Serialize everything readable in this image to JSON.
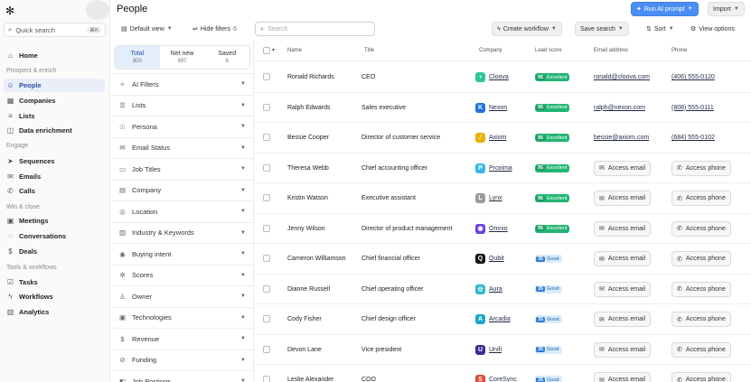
{
  "sidebar": {
    "quick_search": {
      "label": "Quick search",
      "shortcut": "⌘K"
    },
    "sections": [
      {
        "title": "",
        "items": [
          {
            "label": "Home",
            "icon": "home-icon",
            "glyph": "⌂"
          }
        ]
      },
      {
        "title": "Prospect & enrich",
        "items": [
          {
            "label": "People",
            "icon": "people-icon",
            "glyph": "☺",
            "active": true
          },
          {
            "label": "Companies",
            "icon": "building-icon",
            "glyph": "▦"
          },
          {
            "label": "Lists",
            "icon": "list-icon",
            "glyph": "≡"
          },
          {
            "label": "Data enrichment",
            "icon": "database-icon",
            "glyph": "◫"
          }
        ]
      },
      {
        "title": "Engage",
        "items": [
          {
            "label": "Sequences",
            "icon": "send-icon",
            "glyph": "➤"
          },
          {
            "label": "Emails",
            "icon": "mail-icon",
            "glyph": "✉"
          },
          {
            "label": "Calls",
            "icon": "phone-icon",
            "glyph": "✆"
          }
        ]
      },
      {
        "title": "Win & close",
        "items": [
          {
            "label": "Meetings",
            "icon": "calendar-icon",
            "glyph": "▣"
          },
          {
            "label": "Conversations",
            "icon": "chat-icon",
            "glyph": "◌"
          },
          {
            "label": "Deals",
            "icon": "dollar-icon",
            "glyph": "$"
          }
        ]
      },
      {
        "title": "Tools & workflows",
        "items": [
          {
            "label": "Tasks",
            "icon": "checklist-icon",
            "glyph": "☑"
          },
          {
            "label": "Workflows",
            "icon": "bolt-icon",
            "glyph": "ϟ"
          },
          {
            "label": "Analytics",
            "icon": "chart-icon",
            "glyph": "▥"
          }
        ]
      }
    ]
  },
  "header": {
    "title": "People",
    "view": "Default view",
    "hide_filters": "Hide filters",
    "filter_count": "6",
    "search_placeholder": "Search",
    "create_workflow": "Create workflow",
    "save_search": "Save search",
    "sort": "Sort",
    "view_options": "View options",
    "run_ai": "Run AI prompt",
    "import": "Import"
  },
  "counts": [
    {
      "label": "Total",
      "value": "900",
      "active": true
    },
    {
      "label": "Net new",
      "value": "897"
    },
    {
      "label": "Saved",
      "value": "6"
    }
  ],
  "filters": [
    {
      "label": "AI Filters",
      "icon": "sparkle-icon",
      "glyph": "✧"
    },
    {
      "label": "Lists",
      "icon": "list-icon",
      "glyph": "☰"
    },
    {
      "label": "Persona",
      "icon": "persona-icon",
      "glyph": "☉"
    },
    {
      "label": "Email Status",
      "icon": "mail-icon",
      "glyph": "✉"
    },
    {
      "label": "Job Titles",
      "icon": "briefcase-icon",
      "glyph": "▭"
    },
    {
      "label": "Company",
      "icon": "building-icon",
      "glyph": "▤"
    },
    {
      "label": "Location",
      "icon": "location-icon",
      "glyph": "◎"
    },
    {
      "label": "Industry & Keywords",
      "icon": "industry-icon",
      "glyph": "▥"
    },
    {
      "label": "Buying intent",
      "icon": "target-icon",
      "glyph": "◉"
    },
    {
      "label": "Scores",
      "icon": "scores-icon",
      "glyph": "✲"
    },
    {
      "label": "Owner",
      "icon": "user-icon",
      "glyph": "♙"
    },
    {
      "label": "Technologies",
      "icon": "chip-icon",
      "glyph": "▣"
    },
    {
      "label": "Revenue",
      "icon": "revenue-icon",
      "glyph": "$"
    },
    {
      "label": "Funding",
      "icon": "funding-icon",
      "glyph": "⊘"
    },
    {
      "label": "Job Postings",
      "icon": "postings-icon",
      "glyph": "◧"
    }
  ],
  "table": {
    "columns": {
      "name": "Name",
      "title": "Title",
      "company": "Company",
      "lead_score": "Lead score",
      "email": "Email address",
      "phone": "Phone"
    },
    "access_email": "Access email",
    "access_phone": "Access phone",
    "rows": [
      {
        "name": "Ronald Richards",
        "title": "CEO",
        "company": "Cloova",
        "logo_color": "#2fc59a",
        "logo_glyph": "◖",
        "score": "95",
        "score_label": "Excellent",
        "score_tier": "excellent",
        "email": "ronald@cloova.com",
        "phone": "(406) 555-0120"
      },
      {
        "name": "Ralph Edwards",
        "title": "Sales executive",
        "company": "Nexon",
        "logo_color": "#1f6fe0",
        "logo_glyph": "K",
        "score": "95",
        "score_label": "Excellent",
        "score_tier": "excellent",
        "email": "ralph@nexon.com",
        "phone": "(808) 555-0111"
      },
      {
        "name": "Bessie Cooper",
        "title": "Director of customer service",
        "company": "Axiom",
        "logo_color": "#e7b400",
        "logo_glyph": "⁄",
        "score": "95",
        "score_label": "Excellent",
        "score_tier": "excellent",
        "email": "bessie@axiom.com",
        "phone": "(684) 555-0102"
      },
      {
        "name": "Theresa Webb",
        "title": "Chief accounting officer",
        "company": "Proxima",
        "logo_color": "#38b8e6",
        "logo_glyph": "P",
        "score": "95",
        "score_label": "Excellent",
        "score_tier": "excellent",
        "email": "",
        "phone": ""
      },
      {
        "name": "Kristin Watson",
        "title": "Executive assistant",
        "company": "Lynx",
        "logo_color": "#9a9a9a",
        "logo_glyph": "L",
        "score": "95",
        "score_label": "Excellent",
        "score_tier": "excellent",
        "email": "",
        "phone": ""
      },
      {
        "name": "Jenny Wilson",
        "title": "Director of product management",
        "company": "Omnio",
        "logo_color": "#6b3fe0",
        "logo_glyph": "◉",
        "score": "95",
        "score_label": "Excellent",
        "score_tier": "excellent",
        "email": "",
        "phone": ""
      },
      {
        "name": "Cameron Williamson",
        "title": "Chief financial officer",
        "company": "Qubit",
        "logo_color": "#111111",
        "logo_glyph": "Q",
        "score": "35",
        "score_label": "Good",
        "score_tier": "good",
        "email": "",
        "phone": ""
      },
      {
        "name": "Dianne Russell",
        "title": "Chief operating officer",
        "company": "Aura",
        "logo_color": "#2bb8c8",
        "logo_glyph": "◎",
        "score": "35",
        "score_label": "Good",
        "score_tier": "good",
        "email": "",
        "phone": ""
      },
      {
        "name": "Cody Fisher",
        "title": "Chief design officer",
        "company": "Arcadia",
        "logo_color": "#1fa6c9",
        "logo_glyph": "A",
        "score": "35",
        "score_label": "Good",
        "score_tier": "good",
        "email": "",
        "phone": ""
      },
      {
        "name": "Devon Lane",
        "title": "Vice president",
        "company": "Unifi",
        "logo_color": "#3a2b8f",
        "logo_glyph": "U",
        "score": "35",
        "score_label": "Good",
        "score_tier": "good",
        "email": "",
        "phone": ""
      },
      {
        "name": "Leslie Alexander",
        "title": "COO",
        "company": "CoreSync",
        "logo_color": "#e04a3a",
        "logo_glyph": "S",
        "score": "35",
        "score_label": "Good",
        "score_tier": "good",
        "email": "",
        "phone": ""
      }
    ]
  }
}
